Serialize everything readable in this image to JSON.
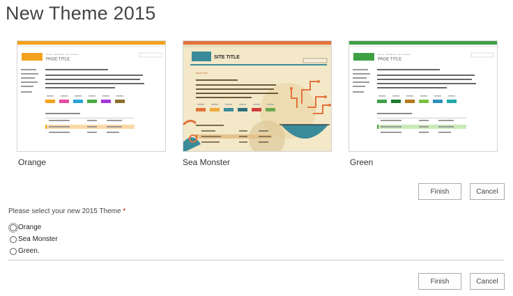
{
  "page": {
    "title": "New Theme 2015"
  },
  "themes": [
    {
      "name": "Orange",
      "accent": "#f4a11c",
      "swatch": [
        "#f4a11c",
        "#e74b9f",
        "#29a4d9",
        "#49a942",
        "#a434d7",
        "#8c6d2c"
      ],
      "highlight": "#fbd8a6"
    },
    {
      "name": "Sea Monster",
      "accent": "#e2723b",
      "swatch": [
        "#e2723b",
        "#f2a93b",
        "#3a8b9a",
        "#2d6e7e",
        "#cf3c3c",
        "#6aa84f"
      ],
      "highlight": "#e6c28a"
    },
    {
      "name": "Green",
      "accent": "#3fa145",
      "swatch": [
        "#3fa145",
        "#1e7b30",
        "#b07a1a",
        "#7ac143",
        "#2f8fbc",
        "#20a8a8"
      ],
      "highlight": "#c9ebb8"
    }
  ],
  "preview": {
    "page_title": "PAGE TITLE",
    "site_title": "SITE TITLE"
  },
  "buttons": {
    "finish": "Finish",
    "cancel": "Cancel"
  },
  "question": {
    "label": "Please select your new 2015 Theme",
    "required_mark": "*",
    "options": [
      "Orange",
      "Sea Monster",
      "Green."
    ]
  }
}
